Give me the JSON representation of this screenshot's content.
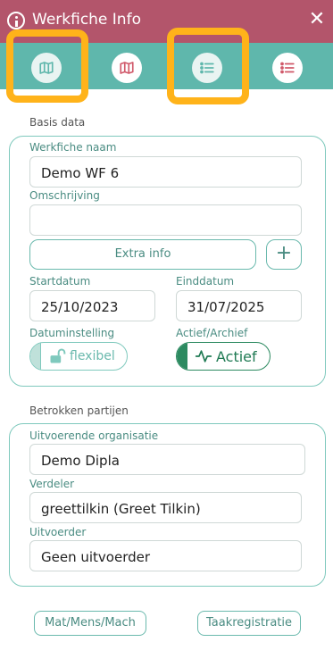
{
  "header": {
    "title": "Werkfiche Info",
    "close_label": "✕",
    "color": "#b3556b"
  },
  "tabs": [
    {
      "icon": "map-icon",
      "active": true
    },
    {
      "icon": "map-icon",
      "active": false
    },
    {
      "icon": "list-icon",
      "active": true
    },
    {
      "icon": "list-icon",
      "active": false
    }
  ],
  "basis": {
    "title": "Basis data",
    "naam_label": "Werkfiche naam",
    "naam_value": "Demo WF 6",
    "omschrijving_label": "Omschrijving",
    "omschrijving_value": "",
    "extra_info_label": "Extra info",
    "add_label": "+",
    "startdatum_label": "Startdatum",
    "startdatum_value": "25/10/2023",
    "einddatum_label": "Einddatum",
    "einddatum_value": "31/07/2025",
    "datuminstelling_label": "Datuminstelling",
    "datuminstelling_value": "flexibel",
    "actief_label": "Actief/Archief",
    "actief_value": "Actief"
  },
  "partijen": {
    "title": "Betrokken partijen",
    "organisatie_label": "Uitvoerende organisatie",
    "organisatie_value": "Demo Dipla",
    "verdeler_label": "Verdeler",
    "verdeler_value": "greettilkin (Greet Tilkin)",
    "uitvoerder_label": "Uitvoerder",
    "uitvoerder_value": "Geen uitvoerder"
  },
  "bottom": {
    "mat_label": "Mat/Mens/Mach",
    "taak_label": "Taakregistratie"
  },
  "colors": {
    "accent": "#5fb7ac",
    "highlight": "#ffb31a",
    "tab_icon_teal": "#5fb7ac",
    "tab_icon_red": "#d0596a",
    "actief_green": "#2c8a60"
  }
}
